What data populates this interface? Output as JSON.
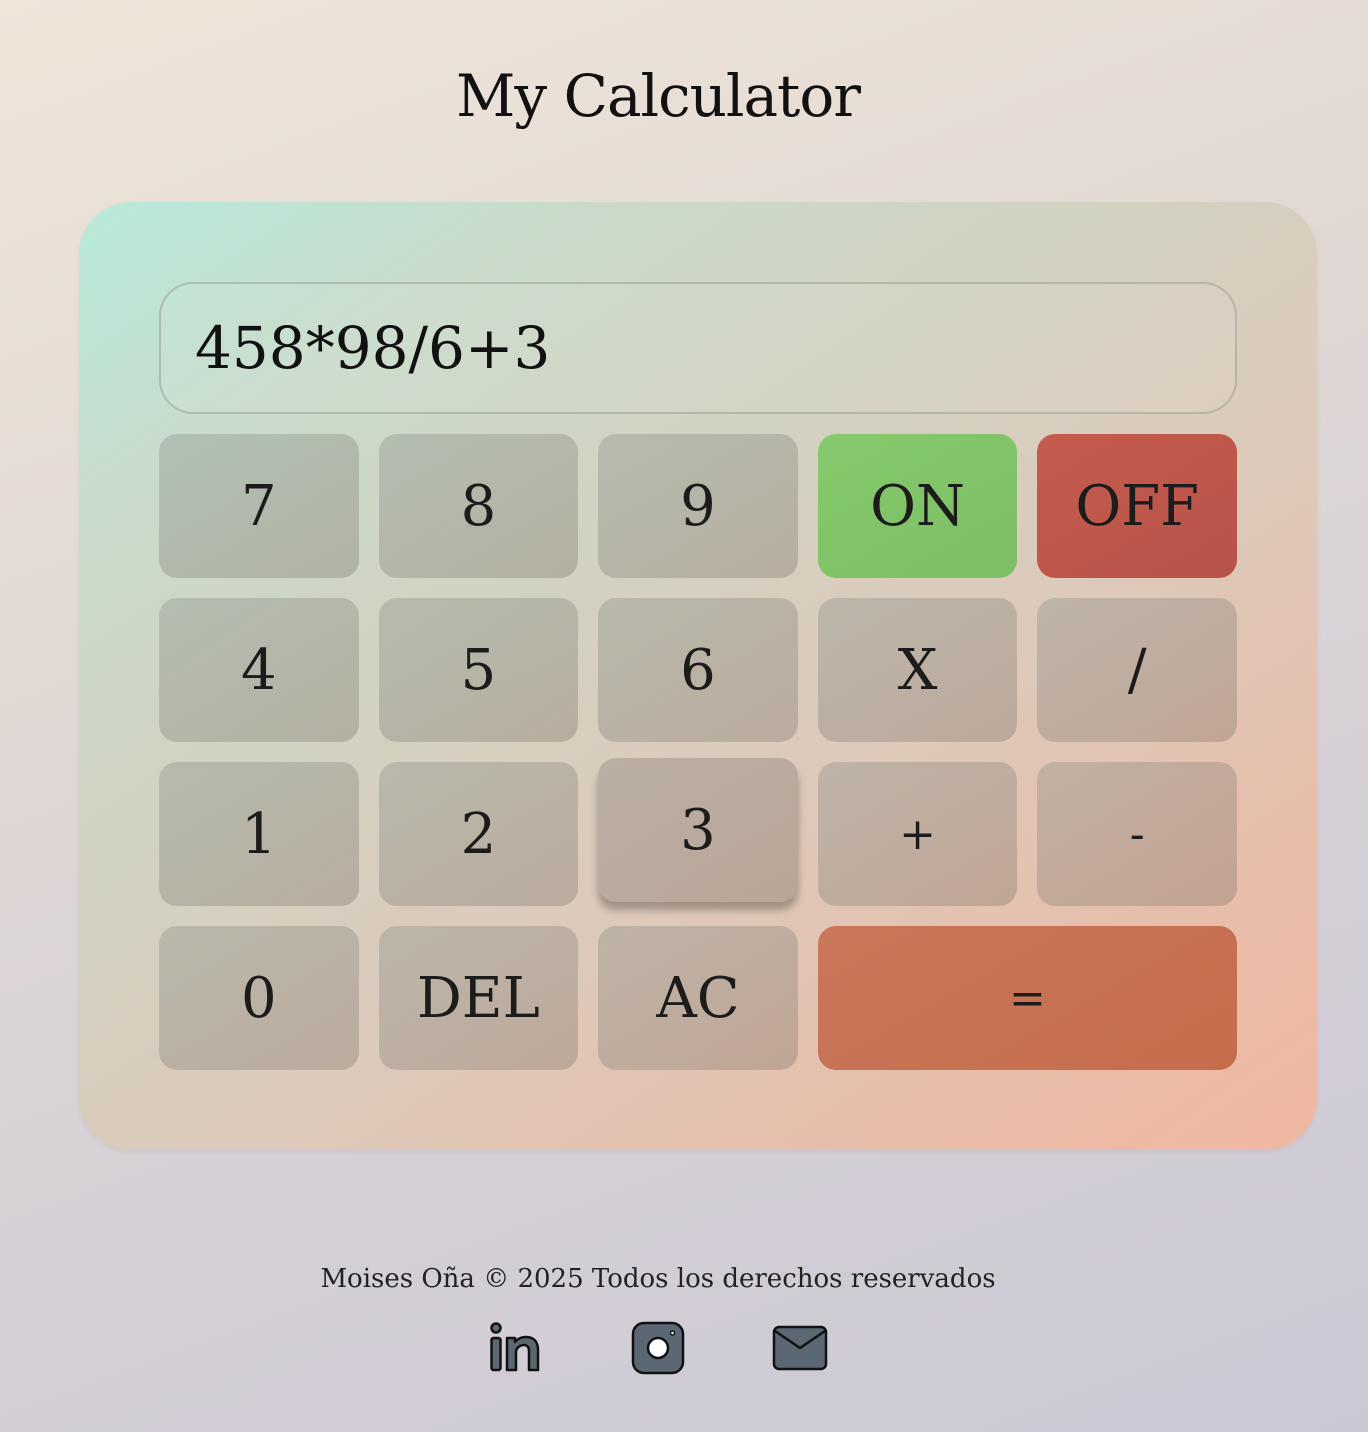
{
  "header": {
    "title": "My Calculator"
  },
  "display": {
    "value": "458*98/6+3"
  },
  "keys": {
    "k7": "7",
    "k8": "8",
    "k9": "9",
    "on": "ON",
    "off": "OFF",
    "k4": "4",
    "k5": "5",
    "k6": "6",
    "multiply": "X",
    "divide": "/",
    "k1": "1",
    "k2": "2",
    "k3": "3",
    "plus": "+",
    "minus": "-",
    "k0": "0",
    "del": "DEL",
    "ac": "AC",
    "equals": "="
  },
  "footer": {
    "copyright": "Moises Oña © 2025 Todos los derechos reservados",
    "links": [
      {
        "icon": "linkedin-icon"
      },
      {
        "icon": "instagram-icon"
      },
      {
        "icon": "mail-icon"
      }
    ]
  },
  "colors": {
    "on_button": "#85ca6c",
    "off_button": "#c65b4f",
    "equals_button": "#c9765a",
    "icon_fill": "#5b6874"
  }
}
